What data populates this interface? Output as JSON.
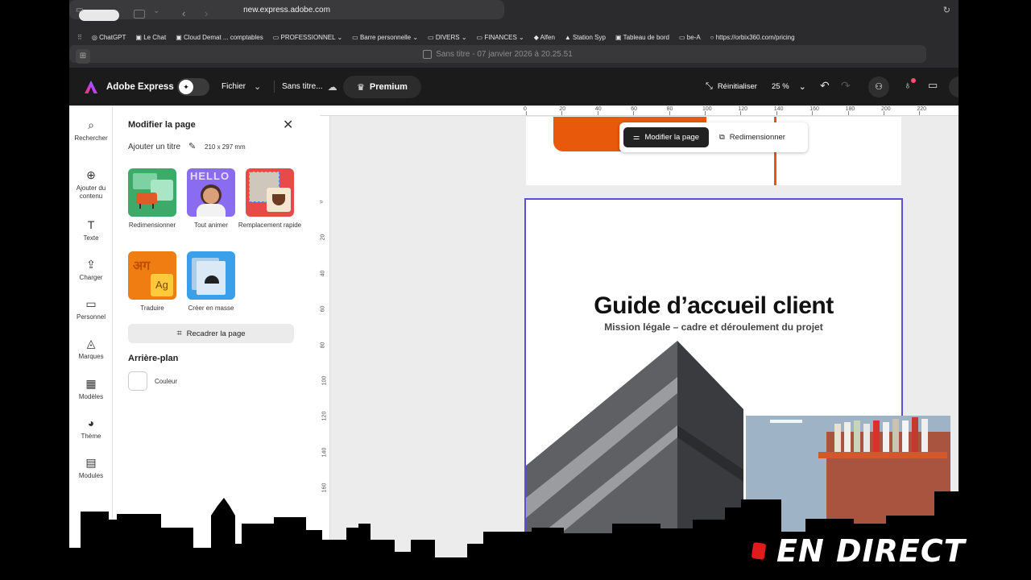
{
  "browser": {
    "url": "new.express.adobe.com",
    "tab_title": "Sans titre - 07 janvier 2026 à 20.25.51",
    "bookmarks": [
      "ChatGPT",
      "Le Chat",
      "Cloud Demat ... comptables",
      "PROFESSIONNEL",
      "Barre personnelle",
      "DIVERS",
      "FINANCES",
      "Alfen",
      "Station Syp",
      "Tableau de bord",
      "be-A",
      "https://orbix360.com/pricing"
    ]
  },
  "header": {
    "app_name": "Adobe Express",
    "file_menu": "Fichier",
    "doc_name": "Sans titre...",
    "premium": "Premium",
    "reset": "Réinitialiser",
    "zoom": "25 %"
  },
  "rail": {
    "items": [
      {
        "label": "Rechercher",
        "icon": "search-icon"
      },
      {
        "label": "Ajouter du contenu",
        "icon": "plus-circle-icon"
      },
      {
        "label": "Texte",
        "icon": "text-icon"
      },
      {
        "label": "Charger",
        "icon": "upload-icon"
      },
      {
        "label": "Personnel",
        "icon": "folder-icon"
      },
      {
        "label": "Marques",
        "icon": "brand-icon"
      },
      {
        "label": "Modèles",
        "icon": "template-icon"
      },
      {
        "label": "Thème",
        "icon": "palette-icon"
      },
      {
        "label": "Modules",
        "icon": "modules-icon"
      }
    ]
  },
  "panel": {
    "title": "Modifier la page",
    "add_title": "Ajouter un titre",
    "dimensions": "210 x 297 mm",
    "tiles": [
      {
        "label": "Redimensionner"
      },
      {
        "label": "Tout animer",
        "image_text": "HELLO"
      },
      {
        "label": "Remplacement rapide"
      },
      {
        "label": "Traduire",
        "image_text": "अग",
        "image_text2": "Ag"
      },
      {
        "label": "Créer en masse"
      }
    ],
    "recrop_button": "Recadrer la page",
    "background_heading": "Arrière-plan",
    "color_label": "Couleur"
  },
  "canvas": {
    "ruler_top_labels": [
      "0",
      "20",
      "40",
      "60",
      "80",
      "100",
      "120",
      "140",
      "160",
      "180",
      "200",
      "220"
    ],
    "ruler_left_labels": [
      "0",
      "20",
      "40",
      "60",
      "80",
      "100",
      "120",
      "140",
      "160"
    ],
    "toolbar": {
      "edit_page": "Modifier la page",
      "resize": "Redimensionner"
    },
    "page_title": "Guide d’accueil client",
    "page_subtitle": "Mission légale – cadre et déroulement du projet"
  },
  "overlay": {
    "live_text": "EN DIRECT"
  },
  "colors": {
    "accent_orange": "#e8590c",
    "page_border": "#5b4fd6",
    "live_red": "#e01b1b"
  }
}
